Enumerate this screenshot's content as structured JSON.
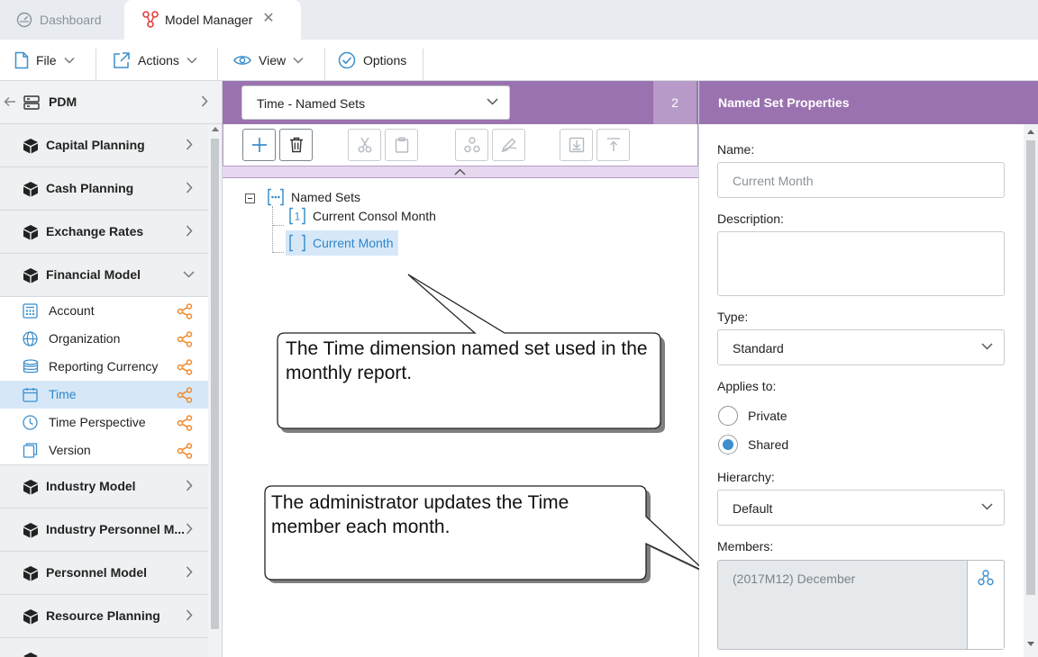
{
  "tabs": [
    {
      "label": "Dashboard",
      "icon": "dashboard-gauge-icon",
      "active": false
    },
    {
      "label": "Model Manager",
      "icon": "model-manager-icon",
      "active": true
    }
  ],
  "menu": {
    "file": "File",
    "actions": "Actions",
    "view": "View",
    "options": "Options"
  },
  "sidebar": {
    "header": "PDM",
    "models_top": [
      {
        "label": "Capital Planning"
      },
      {
        "label": "Cash Planning"
      },
      {
        "label": "Exchange Rates"
      }
    ],
    "open_model": {
      "label": "Financial Model"
    },
    "dimensions": [
      {
        "label": "Account",
        "icon": "calculator-icon"
      },
      {
        "label": "Organization",
        "icon": "globe-icon"
      },
      {
        "label": "Reporting Currency",
        "icon": "coins-icon"
      },
      {
        "label": "Time",
        "icon": "calendar-icon",
        "selected": true
      },
      {
        "label": "Time Perspective",
        "icon": "clock-icon"
      },
      {
        "label": "Version",
        "icon": "pages-icon"
      }
    ],
    "models_bottom": [
      {
        "label": "Industry Model"
      },
      {
        "label": "Industry Personnel M..."
      },
      {
        "label": "Personnel Model"
      },
      {
        "label": "Resource Planning"
      }
    ],
    "share_color": "#f08a2c"
  },
  "center": {
    "dimension_select": "Time - Named Sets",
    "count": "2",
    "tree": {
      "root": "Named Sets",
      "children": [
        {
          "label": "Current Consol Month",
          "icon_text": "1"
        },
        {
          "label": "Current Month",
          "selected": true
        }
      ]
    }
  },
  "callouts": {
    "first": "The Time dimension named set used in the monthly report.",
    "second": "The administrator updates the Time member each month."
  },
  "properties": {
    "title": "Named Set Properties",
    "name_label": "Name:",
    "name_value": "Current Month",
    "description_label": "Description:",
    "type_label": "Type:",
    "type_value": "Standard",
    "applies_label": "Applies to:",
    "applies_private": "Private",
    "applies_shared": "Shared",
    "applies_selected": "Shared",
    "hierarchy_label": "Hierarchy:",
    "hierarchy_value": "Default",
    "members_label": "Members:",
    "members_value": "(2017M12) December"
  },
  "colors": {
    "header_purple": "#9b72b0",
    "selection_blue": "#d6e8f8",
    "accent_blue": "#2f86c9"
  }
}
